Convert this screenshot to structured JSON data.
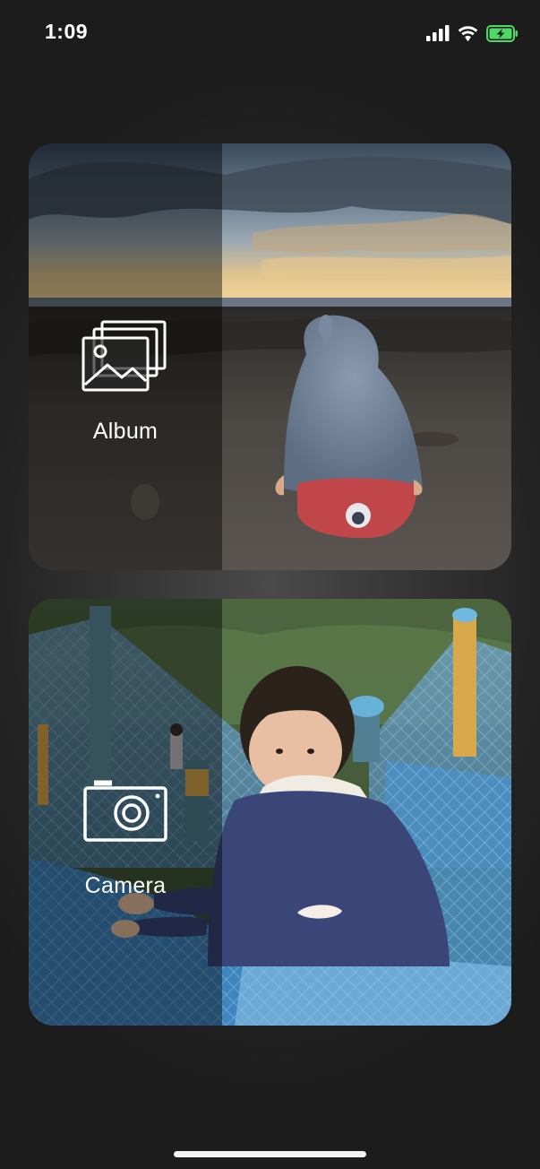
{
  "status_bar": {
    "time": "1:09",
    "icons": [
      "cellular-signal-icon",
      "wifi-icon",
      "battery-charging-icon"
    ],
    "battery_color": "#4cd964"
  },
  "options": {
    "album": {
      "label": "Album",
      "icon": "photo-album-icon"
    },
    "camera": {
      "label": "Camera",
      "icon": "camera-icon"
    }
  },
  "colors": {
    "background": "#2a2a2a",
    "overlay": "rgba(0,0,0,0.42)",
    "label": "#ffffff"
  }
}
